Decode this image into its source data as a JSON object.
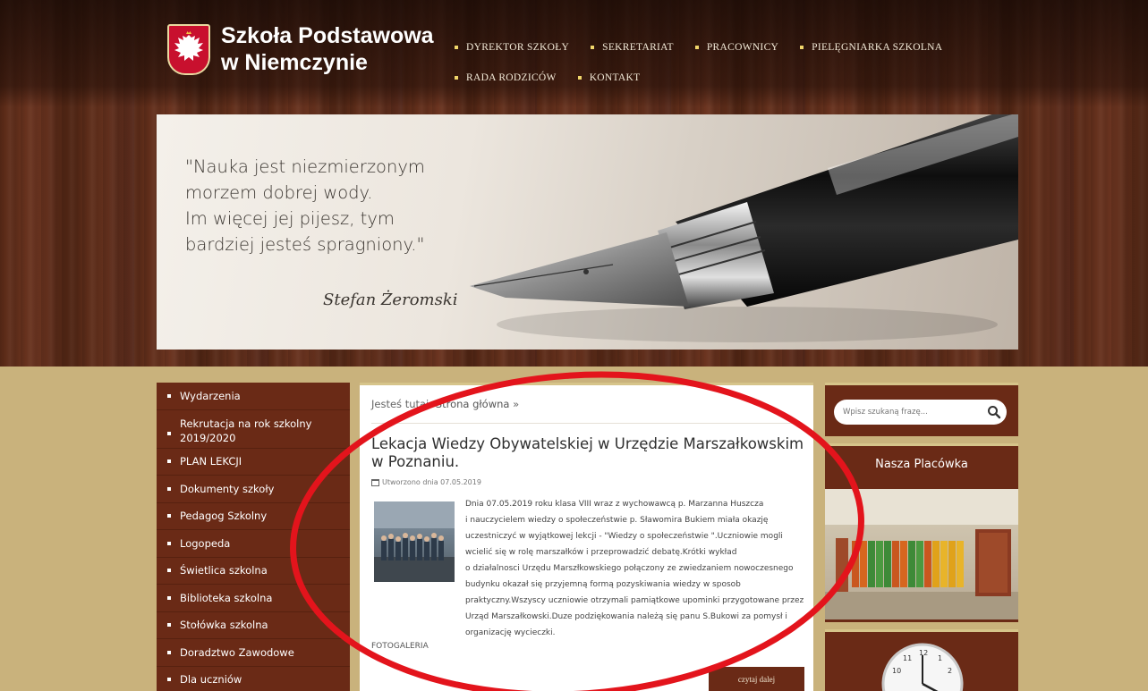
{
  "header": {
    "school_name_line1": "Szkoła Podstawowa",
    "school_name_line2": "w Niemczynie",
    "nav": [
      "DYREKTOR SZKOŁY",
      "SEKRETARIAT",
      "PRACOWNICY",
      "PIELĘGNIARKA SZKOLNA",
      "RADA RODZICÓW",
      "KONTAKT"
    ]
  },
  "hero": {
    "quote_lines": [
      "\"Nauka jest niezmierzonym",
      "morzem dobrej wody.",
      "Im więcej jej pijesz, tym",
      "bardziej jesteś spragniony.\""
    ],
    "author": "Stefan Żeromski"
  },
  "sidebar": {
    "items": [
      "Wydarzenia",
      "Rekrutacja na rok szkolny 2019/2020",
      "PLAN LEKCJI",
      "Dokumenty szkoły",
      "Pedagog Szkolny",
      "Logopeda",
      "Świetlica szkolna",
      "Biblioteka szkolna",
      "Stołówka szkolna",
      "Doradztwo Zawodowe",
      "Dla uczniów"
    ]
  },
  "main": {
    "breadcrumb_prefix": "Jesteś tutaj:",
    "breadcrumb_link": "Strona główna",
    "breadcrumb_sep": "»",
    "title": "Lekacja Wiedzy Obywatelskiej w Urzędzie Marszałkowskim w Poznaniu.",
    "meta": "Utworzono dnia 07.05.2019",
    "paragraphs": [
      "Dnia 07.05.2019 roku klasa VIII wraz z wychowawcą p. Marzanna Huszcza",
      "i nauczycielem wiedzy o społeczeństwie p. Sławomira Bukiem miała okazję uczestniczyć w wyjątkowej lekcji - \"Wiedzy o społeczeństwie \".Uczniowie mogli wcielić się w rolę marszałków i przeprowadzić debatę.Krótki wykład",
      "o działalnosci Urzędu Marszłkowskiego połączony ze zwiedzaniem nowoczesnego budynku okazał się przyjemną formą pozyskiwania wiedzy w sposob praktyczny.Wszyscy uczniowie otrzymali pamiątkowe upominki przygotowane przez Urząd Marszałkowski.Duze podziękowania należą się panu S.Bukowi za pomysł i organizację wycieczki."
    ],
    "gallery_label": "FOTOGALERIA",
    "read_more": "czytaj dalej"
  },
  "right": {
    "search_placeholder": "Wpisz szukaną frazę...",
    "place_title": "Nasza Placówka"
  }
}
